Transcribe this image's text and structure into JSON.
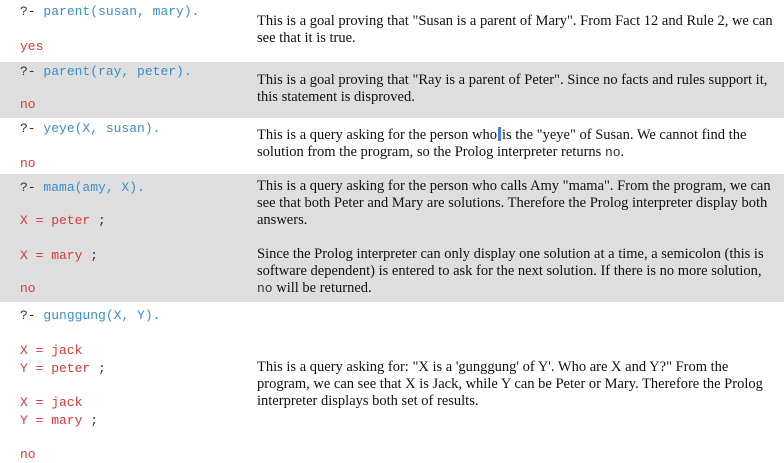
{
  "rows": [
    {
      "prompt": "?-",
      "query": "parent(susan, mary).",
      "answer": "yes",
      "text": "This is a goal proving that \"Susan is a parent of Mary\". From Fact 12 and Rule 2, we can see that it is true."
    },
    {
      "prompt": "?-",
      "query": "parent(ray, peter).",
      "answer": "no",
      "text": "This is a goal proving that \"Ray is a parent of Peter\". Since no facts and rules support it, this statement is disproved."
    },
    {
      "prompt": "?-",
      "query": "yeye(X, susan).",
      "answer": "no",
      "text_a": "This is a query asking for the person who",
      "text_b": "is the \"yeye\" of Susan. We cannot find the solution from the program, so the Prolog interpreter returns ",
      "text_code": "no",
      "text_end": "."
    },
    {
      "prompt": "?-",
      "query": "mama(amy, X).",
      "result1": "X = peter",
      "result2": "X = mary",
      "semicolon": ";",
      "answer": "no",
      "text1": "This is a query asking for the person who calls Amy \"mama\". From the program, we can see that both Peter and Mary are solutions. Therefore the Prolog interpreter display both answers.",
      "text2_a": "Since the Prolog interpreter can only display one solution at a time, a semicolon (this is software dependent) is entered to ask for the next solution. If there is no more solution, ",
      "text2_code": "no",
      "text2_b": " will be returned."
    },
    {
      "prompt": "?-",
      "query": "gunggung(X, Y).",
      "r1x": "X = jack",
      "r1y": "Y = peter",
      "r2x": "X = jack",
      "r2y": "Y = mary",
      "semicolon": ";",
      "answer": "no",
      "text": "This is a query asking for: \"X is a 'gunggung' of Y'. Who are X and Y?\" From the program, we can see that X is Jack, while Y can be Peter or Mary. Therefore the Prolog interpreter displays both set of results."
    }
  ]
}
